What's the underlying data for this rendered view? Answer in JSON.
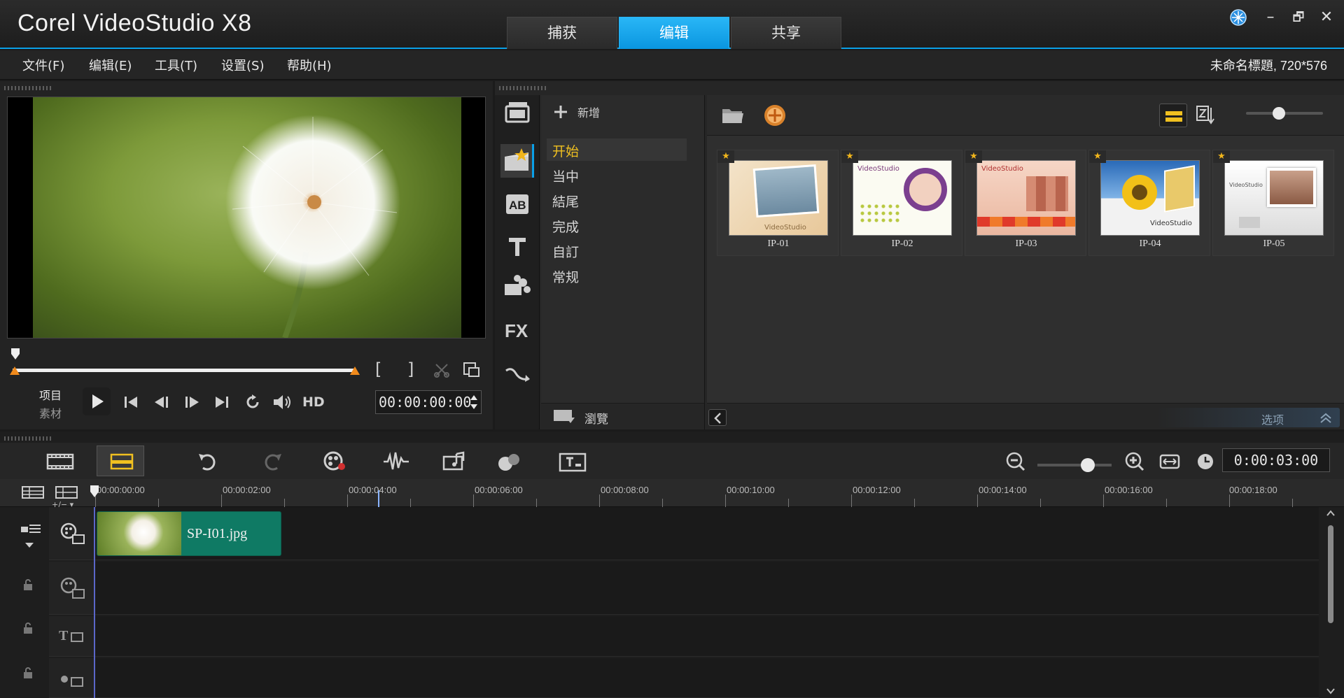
{
  "app": {
    "title": "Corel VideoStudio X8"
  },
  "mode_tabs": [
    {
      "label": "捕获",
      "active": false
    },
    {
      "label": "编辑",
      "active": true
    },
    {
      "label": "共享",
      "active": false
    }
  ],
  "window_controls": {
    "minimize": "–",
    "restore": "🗗",
    "close": "✕"
  },
  "menu": {
    "items": [
      "文件(F)",
      "编辑(E)",
      "工具(T)",
      "设置(S)",
      "帮助(H)"
    ],
    "project_info": "未命名標題, 720*576"
  },
  "player": {
    "mode_project": "项目",
    "mode_clip": "素材",
    "mark_in": "[",
    "mark_out": "]",
    "hd_label": "HD",
    "timecode": "00:00:00:00"
  },
  "library": {
    "add_label": "新增",
    "categories": [
      "开始",
      "当中",
      "結尾",
      "完成",
      "自訂",
      "常规"
    ],
    "selected_category": "开始",
    "browse_label": "瀏覽",
    "options_label": "选项",
    "fx_label": "FX",
    "thumbnails": [
      {
        "label": "IP-01",
        "caption": "VideoStudio"
      },
      {
        "label": "IP-02",
        "caption": "VideoStudio"
      },
      {
        "label": "IP-03",
        "caption": "VideoStudio"
      },
      {
        "label": "IP-04",
        "caption": "VideoStudio"
      },
      {
        "label": "IP-05",
        "caption": "VideoStudio"
      }
    ]
  },
  "timeline": {
    "duration": "0:00:03:00",
    "track_add_label": "+/− ▾",
    "ruler_labels": [
      "00:00:00:00",
      "00:00:02:00",
      "00:00:04:00",
      "00:00:06:00",
      "00:00:08:00",
      "00:00:10:00",
      "00:00:12:00",
      "00:00:14:00",
      "00:00:16:00",
      "00:00:18:00"
    ],
    "clip": {
      "name": "SP-I01.jpg"
    }
  },
  "colors": {
    "accent": "#0aa0e8",
    "clip_bg": "#0f7a64",
    "selected_text": "#f0c020"
  }
}
